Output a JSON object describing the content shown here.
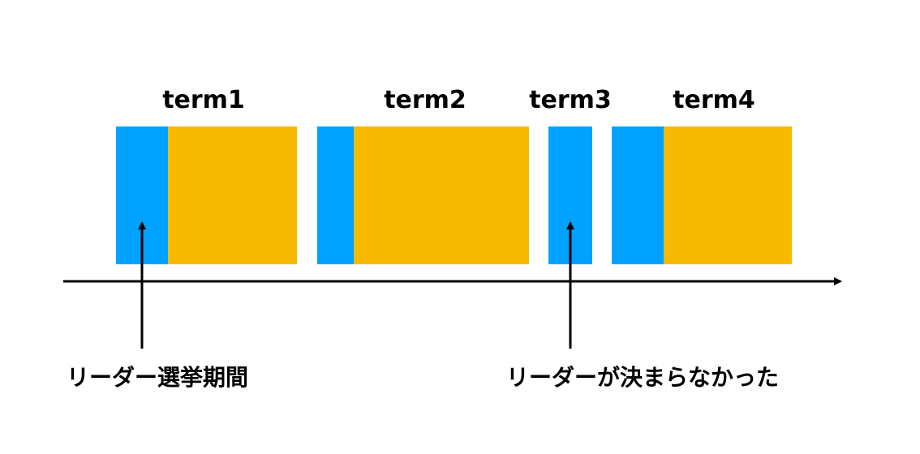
{
  "colors": {
    "election": "#00a2ff",
    "leader": "#f8ba00",
    "axis": "#000000",
    "background": "#ffffff"
  },
  "terms": [
    {
      "label": "term1"
    },
    {
      "label": "term2"
    },
    {
      "label": "term3"
    },
    {
      "label": "term4"
    }
  ],
  "annotations": {
    "election_period": "リーダー選挙期間",
    "no_leader": "リーダーが決まらなかった"
  }
}
